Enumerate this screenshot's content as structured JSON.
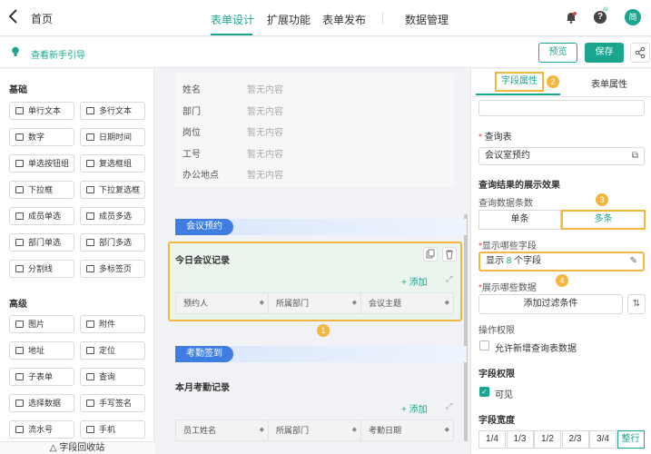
{
  "header": {
    "home_label": "首页",
    "tabs": [
      "表单设计",
      "扩展功能",
      "表单发布",
      "数据管理"
    ],
    "ai_badge": "AI",
    "avatar_text": "简"
  },
  "toolbar": {
    "guide_label": "查看新手引导",
    "preview_label": "预览",
    "save_label": "保存"
  },
  "left_panel": {
    "basic_title": "基础",
    "basic_fields": [
      "单行文本",
      "多行文本",
      "数字",
      "日期时间",
      "单选按钮组",
      "复选框组",
      "下拉框",
      "下拉复选框",
      "成员单选",
      "成员多选",
      "部门单选",
      "部门多选",
      "分割线",
      "多标签页"
    ],
    "advanced_title": "高级",
    "advanced_fields": [
      "图片",
      "附件",
      "地址",
      "定位",
      "子表单",
      "查询",
      "选择数据",
      "手写签名",
      "流水号",
      "手机"
    ],
    "recycle_label": "字段回收站"
  },
  "canvas": {
    "info_rows": [
      {
        "label": "姓名",
        "value": "暂无内容"
      },
      {
        "label": "部门",
        "value": "暂无内容"
      },
      {
        "label": "岗位",
        "value": "暂无内容"
      },
      {
        "label": "工号",
        "value": "暂无内容"
      },
      {
        "label": "办公地点",
        "value": "暂无内容"
      }
    ],
    "group1_title": "会议预约",
    "subform1": {
      "title": "今日会议记录",
      "add_label": "+ 添加",
      "columns": [
        "预约人",
        "所属部门",
        "会议主题"
      ]
    },
    "group2_title": "考勤签到",
    "subform2": {
      "title": "本月考勤记录",
      "add_label": "+ 添加",
      "columns": [
        "员工姓名",
        "所属部门",
        "考勤日期"
      ]
    },
    "markers": [
      "1",
      "2",
      "3",
      "4"
    ]
  },
  "right_panel": {
    "tab_field": "字段属性",
    "tab_form": "表单属性",
    "query_table_label": "查询表",
    "query_table_value": "会议室预约",
    "display_effect_title": "查询结果的展示效果",
    "query_count_label": "查询数据条数",
    "count_options": [
      "单条",
      "多条"
    ],
    "show_fields_label": "显示哪些字段",
    "show_fields_prefix": "显示",
    "show_fields_count": "8",
    "show_fields_suffix": "个字段",
    "show_data_label": "展示哪些数据",
    "add_filter_label": "添加过滤条件",
    "op_permission_label": "操作权限",
    "allow_add_label": "允许新增查询表数据",
    "field_permission_label": "字段权限",
    "visible_label": "可见",
    "field_width_label": "字段宽度",
    "width_options": [
      "1/4",
      "1/3",
      "1/2",
      "2/3",
      "3/4",
      "整行"
    ]
  },
  "colors": {
    "accent": "#1aa58f",
    "highlight": "#f4b63f",
    "group": "#3f7ee0"
  }
}
